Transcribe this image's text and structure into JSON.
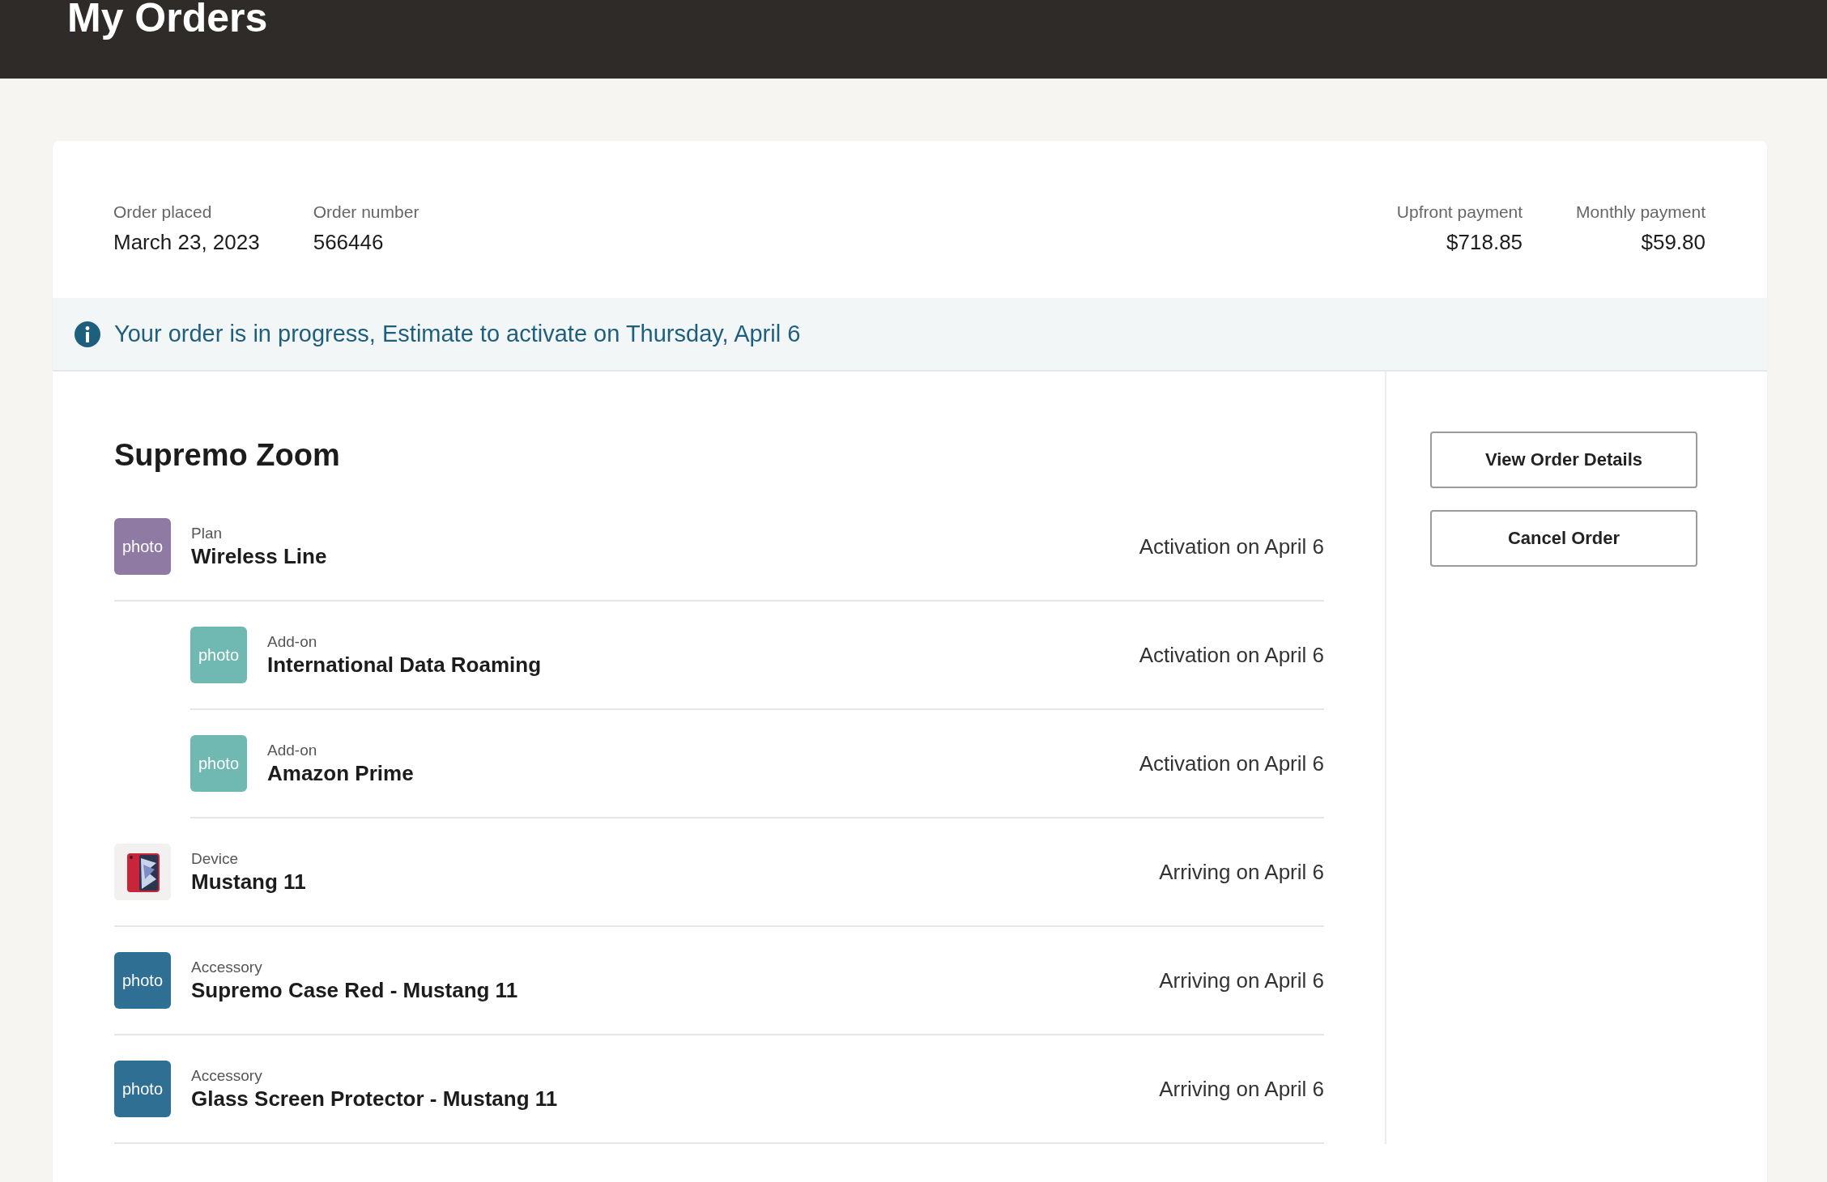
{
  "header": {
    "title": "My Orders"
  },
  "order": {
    "details": [
      {
        "label": "Order placed",
        "value": "March 23, 2023"
      },
      {
        "label": "Order number",
        "value": "566446"
      }
    ],
    "payments": [
      {
        "label": "Upfront payment",
        "value": "$718.85"
      },
      {
        "label": "Monthly payment",
        "value": "$59.80"
      }
    ],
    "banner": {
      "kind": "info",
      "text": "Your order is in progress, Estimate to activate on Thursday, April 6"
    },
    "title": "Supremo Zoom",
    "items": [
      {
        "type": "Plan",
        "name": "Wireless Line",
        "status": "Activation on April 6",
        "thumbnail": {
          "kind": "placeholder",
          "text": "photo",
          "color": "#8f7aa3"
        },
        "children": [
          {
            "type": "Add-on",
            "name": "International Data Roaming",
            "status": "Activation on April 6",
            "thumbnail": {
              "kind": "placeholder",
              "text": "photo",
              "color": "#6fb9b2"
            }
          },
          {
            "type": "Add-on",
            "name": "Amazon Prime",
            "status": "Activation on April 6",
            "thumbnail": {
              "kind": "placeholder",
              "text": "photo",
              "color": "#6fb9b2"
            }
          }
        ]
      },
      {
        "type": "Device",
        "name": "Mustang 11",
        "status": "Arriving on April 6"
      },
      {
        "type": "Accessory",
        "name": "Supremo Case Red - Mustang 11",
        "status": "Arriving on April 6",
        "thumbnail": {
          "kind": "placeholder",
          "text": "photo",
          "color": "#2f6f93"
        }
      },
      {
        "type": "Accessory",
        "name": "Glass Screen Protector - Mustang 11",
        "status": "Arriving on April 6",
        "thumbnail": {
          "kind": "placeholder",
          "text": "photo",
          "color": "#2f6f93"
        }
      }
    ],
    "actions": [
      {
        "label": "View Order Details"
      },
      {
        "label": "Cancel Order"
      }
    ]
  }
}
